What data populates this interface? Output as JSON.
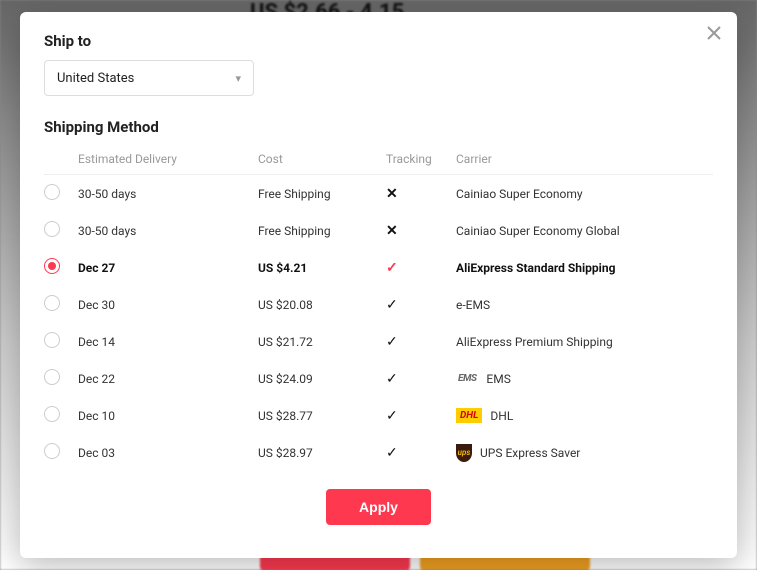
{
  "backdrop": {
    "price_fragment": "US $2.66 - 4.15"
  },
  "header": {
    "ship_to_label": "Ship to",
    "country": "United States",
    "method_label": "Shipping Method"
  },
  "columns": {
    "delivery": "Estimated Delivery",
    "cost": "Cost",
    "tracking": "Tracking",
    "carrier": "Carrier"
  },
  "methods": [
    {
      "delivery": "30-50 days",
      "cost": "Free Shipping",
      "tracking": "no",
      "carrier": "Cainiao Super Economy",
      "logo": null,
      "selected": false
    },
    {
      "delivery": "30-50 days",
      "cost": "Free Shipping",
      "tracking": "no",
      "carrier": "Cainiao Super Economy Global",
      "logo": null,
      "selected": false
    },
    {
      "delivery": "Dec 27",
      "cost": "US $4.21",
      "tracking": "yes",
      "carrier": "AliExpress Standard Shipping",
      "logo": null,
      "selected": true
    },
    {
      "delivery": "Dec 30",
      "cost": "US $20.08",
      "tracking": "yes",
      "carrier": "e-EMS",
      "logo": null,
      "selected": false
    },
    {
      "delivery": "Dec 14",
      "cost": "US $21.72",
      "tracking": "yes",
      "carrier": "AliExpress Premium Shipping",
      "logo": null,
      "selected": false
    },
    {
      "delivery": "Dec 22",
      "cost": "US $24.09",
      "tracking": "yes",
      "carrier": "EMS",
      "logo": "ems",
      "selected": false
    },
    {
      "delivery": "Dec 10",
      "cost": "US $28.77",
      "tracking": "yes",
      "carrier": "DHL",
      "logo": "dhl",
      "selected": false
    },
    {
      "delivery": "Dec 03",
      "cost": "US $28.97",
      "tracking": "yes",
      "carrier": "UPS Express Saver",
      "logo": "ups",
      "selected": false
    }
  ],
  "apply_label": "Apply"
}
